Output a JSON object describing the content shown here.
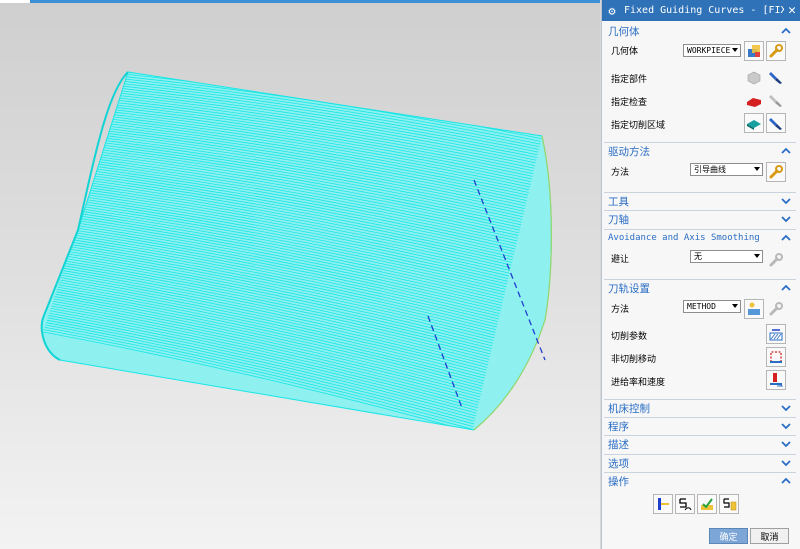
{
  "dialog": {
    "title": "Fixed Guiding Curves - [FIXED...",
    "geometry": {
      "header": "几何体",
      "geometry_label": "几何体",
      "geometry_value": "WORKPIECE",
      "part_label": "指定部件",
      "check_label": "指定检查",
      "cut_area_label": "指定切削区域"
    },
    "drive": {
      "header": "驱动方法",
      "method_label": "方法",
      "method_value": "引导曲线"
    },
    "tool_header": "工具",
    "tool_axis_header": "刀轴",
    "avoidance": {
      "header": "Avoidance and Axis Smoothing",
      "avoid_label": "避让",
      "avoid_value": "无"
    },
    "path_settings": {
      "header": "刀轨设置",
      "method_label": "方法",
      "method_value": "METHOD",
      "cut_params_label": "切削参数",
      "noncut_label": "非切削移动",
      "feeds_label": "进给率和速度"
    },
    "machine_control_header": "机床控制",
    "program_header": "程序",
    "description_header": "描述",
    "options_header": "选项",
    "actions_header": "操作",
    "ok_label": "确定",
    "cancel_label": "取消"
  },
  "colors": {
    "title_bar": "#2f72b8",
    "section_header_text": "#2a6dc4",
    "toolpath": "#18e6e6",
    "guide_curve": "#1f3fd0",
    "ok_button": "#7ba6d6"
  },
  "icons": {
    "title": "gear-icon",
    "geometry": [
      "workpiece-select-icon",
      "geometry-edit-wrench-icon",
      "part-select-icon",
      "part-flashlight-icon",
      "check-select-icon",
      "check-flashlight-icon",
      "cut-area-select-icon",
      "cut-area-flashlight-icon"
    ],
    "drive": "drive-method-edit-wrench-icon",
    "avoidance": "avoidance-edit-wrench-icon",
    "path": [
      "method-create-icon",
      "method-edit-wrench-icon",
      "cut-params-icon",
      "noncut-moves-icon",
      "feeds-speeds-icon"
    ],
    "actions": [
      "generate-icon",
      "replay-icon",
      "verify-icon",
      "list-icon"
    ]
  }
}
